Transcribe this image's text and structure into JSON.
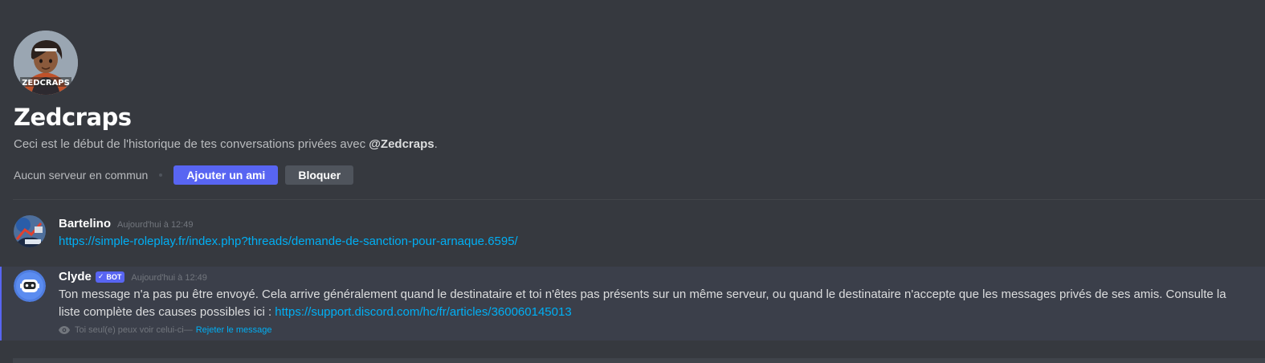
{
  "intro": {
    "avatar_icon": "user-avatar-icon",
    "avatar_caption": "ZEDCRAPS",
    "name": "Zedcraps",
    "description_prefix": "Ceci est le début de l'historique de tes conversations privées avec ",
    "mention": "@Zedcraps",
    "description_suffix": ".",
    "mutual_servers": "Aucun serveur en commun",
    "add_friend_label": "Ajouter un ami",
    "block_label": "Bloquer"
  },
  "messages": [
    {
      "author": "Bartelino",
      "timestamp": "Aujourd'hui à 12:49",
      "link": "https://simple-roleplay.fr/index.php?threads/demande-de-sanction-pour-arnaque.6595/"
    },
    {
      "author": "Clyde",
      "bot_tag": "BOT",
      "bot_check": "✓",
      "timestamp": "Aujourd'hui à 12:49",
      "body_text": "Ton message n'a pas pu être envoyé. Cela arrive généralement quand le destinataire et toi n'êtes pas présents sur un même serveur, ou quand le destinataire n'accepte que les messages privés de ses amis. Consulte la liste complète des causes possibles ici : ",
      "link": "https://support.discord.com/hc/fr/articles/360060145013",
      "ephemeral_note": "Toi seul(e) peux voir celui-ci",
      "ephemeral_sep": " — ",
      "dismiss_label": "Rejeter le message"
    }
  ],
  "colors": {
    "background": "#36393f",
    "highlight": "#3b3f4a",
    "accent": "#5865f2",
    "link": "#00aff4",
    "secondary_button": "#4f545c"
  }
}
